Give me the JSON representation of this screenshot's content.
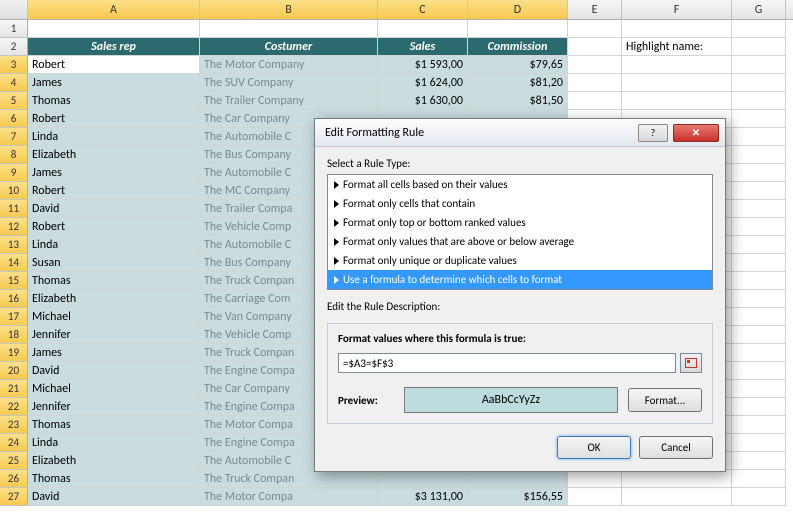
{
  "columns": [
    "A",
    "B",
    "C",
    "D",
    "E",
    "F",
    "G"
  ],
  "selected_cols": [
    "A",
    "B",
    "C",
    "D"
  ],
  "header": {
    "A": "Sales rep",
    "B": "Costumer",
    "C": "Sales",
    "D": "Commission"
  },
  "highlight_label": "Highlight name:",
  "rows": [
    {
      "n": 1,
      "A": "",
      "B": "",
      "C": "",
      "D": ""
    },
    {
      "n": 2,
      "hdr": true
    },
    {
      "n": 3,
      "A": "Robert",
      "B": "The Motor Company",
      "C": "$1 593,00",
      "D": "$79,65"
    },
    {
      "n": 4,
      "A": "James",
      "B": "The SUV Company",
      "C": "$1 624,00",
      "D": "$81,20"
    },
    {
      "n": 5,
      "A": "Thomas",
      "B": "The Trailer Company",
      "C": "$1 630,00",
      "D": "$81,50"
    },
    {
      "n": 6,
      "A": "Robert",
      "B": "The Car Company",
      "C": "",
      "D": ""
    },
    {
      "n": 7,
      "A": "Linda",
      "B": "The Automobile C",
      "C": "",
      "D": ""
    },
    {
      "n": 8,
      "A": "Elizabeth",
      "B": "The Bus Company",
      "C": "",
      "D": ""
    },
    {
      "n": 9,
      "A": "James",
      "B": "The Automobile C",
      "C": "",
      "D": ""
    },
    {
      "n": 10,
      "A": "Robert",
      "B": "The MC Company",
      "C": "",
      "D": ""
    },
    {
      "n": 11,
      "A": "David",
      "B": "The Trailer Compa",
      "C": "",
      "D": ""
    },
    {
      "n": 12,
      "A": "Robert",
      "B": "The Vehicle Comp",
      "C": "",
      "D": ""
    },
    {
      "n": 13,
      "A": "Linda",
      "B": "The Automobile C",
      "C": "",
      "D": ""
    },
    {
      "n": 14,
      "A": "Susan",
      "B": "The Bus Company",
      "C": "",
      "D": ""
    },
    {
      "n": 15,
      "A": "Thomas",
      "B": "The Truck Compan",
      "C": "",
      "D": ""
    },
    {
      "n": 16,
      "A": "Elizabeth",
      "B": "The Carriage Com",
      "C": "",
      "D": ""
    },
    {
      "n": 17,
      "A": "Michael",
      "B": "The Van Company",
      "C": "",
      "D": ""
    },
    {
      "n": 18,
      "A": "Jennifer",
      "B": "The Vehicle Comp",
      "C": "",
      "D": ""
    },
    {
      "n": 19,
      "A": "James",
      "B": "The Truck Compan",
      "C": "",
      "D": ""
    },
    {
      "n": 20,
      "A": "David",
      "B": "The Engine Compa",
      "C": "",
      "D": ""
    },
    {
      "n": 21,
      "A": "Michael",
      "B": "The Car Company",
      "C": "",
      "D": ""
    },
    {
      "n": 22,
      "A": "Jennifer",
      "B": "The Engine Compa",
      "C": "",
      "D": ""
    },
    {
      "n": 23,
      "A": "Thomas",
      "B": "The Motor Compa",
      "C": "",
      "D": ""
    },
    {
      "n": 24,
      "A": "Linda",
      "B": "The Engine Compa",
      "C": "",
      "D": ""
    },
    {
      "n": 25,
      "A": "Elizabeth",
      "B": "The Automobile C",
      "C": "",
      "D": ""
    },
    {
      "n": 26,
      "A": "Thomas",
      "B": "The Truck Compan",
      "C": "",
      "D": ""
    },
    {
      "n": 27,
      "A": "David",
      "B": "The Motor Compa",
      "C": "$3 131,00",
      "D": "$156,55"
    }
  ],
  "dialog": {
    "title": "Edit Formatting Rule",
    "help": "?",
    "close": "✕",
    "select_label": "Select a Rule Type:",
    "rules": [
      "Format all cells based on their values",
      "Format only cells that contain",
      "Format only top or bottom ranked values",
      "Format only values that are above or below average",
      "Format only unique or duplicate values",
      "Use a formula to determine which cells to format"
    ],
    "selected_rule_index": 5,
    "edit_label": "Edit the Rule Description:",
    "formula_label": "Format values where this formula is true:",
    "formula": "=$A3=$F$3",
    "preview_label": "Preview:",
    "preview_text": "AaBbCcYyZz",
    "format_btn": "Format...",
    "ok": "OK",
    "cancel": "Cancel"
  }
}
